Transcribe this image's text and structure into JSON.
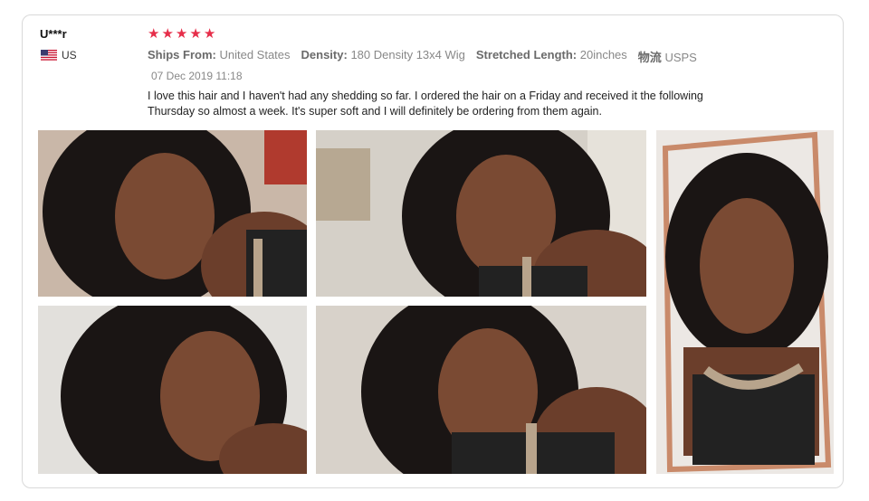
{
  "review": {
    "user": "U***r",
    "country": "US",
    "rating": 5,
    "stars": [
      "★",
      "★",
      "★",
      "★",
      "★"
    ],
    "meta": [
      {
        "label": "Ships From:",
        "value": "United States"
      },
      {
        "label": "Density:",
        "value": "180 Density 13x4 Wig"
      },
      {
        "label": "Stretched Length:",
        "value": "20inches"
      },
      {
        "label": "物流",
        "value": "USPS"
      }
    ],
    "date": "07 Dec 2019 11:18",
    "text": "I love this hair and I haven't had any shedding so far. I ordered the hair on a Friday and received it the following Thursday so almost a week. It's super soft and I will definitely be ordering from them again."
  },
  "colors": {
    "star": "#e62e4a",
    "border": "#d9d9d9",
    "skin": "#7a4a33",
    "hair": "#1a1514",
    "frame": "#c98a6a"
  },
  "photos": [
    {
      "name": "review-photo-1",
      "icon": "photo-icon"
    },
    {
      "name": "review-photo-2",
      "icon": "photo-icon"
    },
    {
      "name": "review-photo-3",
      "icon": "photo-icon"
    },
    {
      "name": "review-photo-4",
      "icon": "photo-icon"
    },
    {
      "name": "review-photo-5",
      "icon": "photo-icon"
    }
  ]
}
